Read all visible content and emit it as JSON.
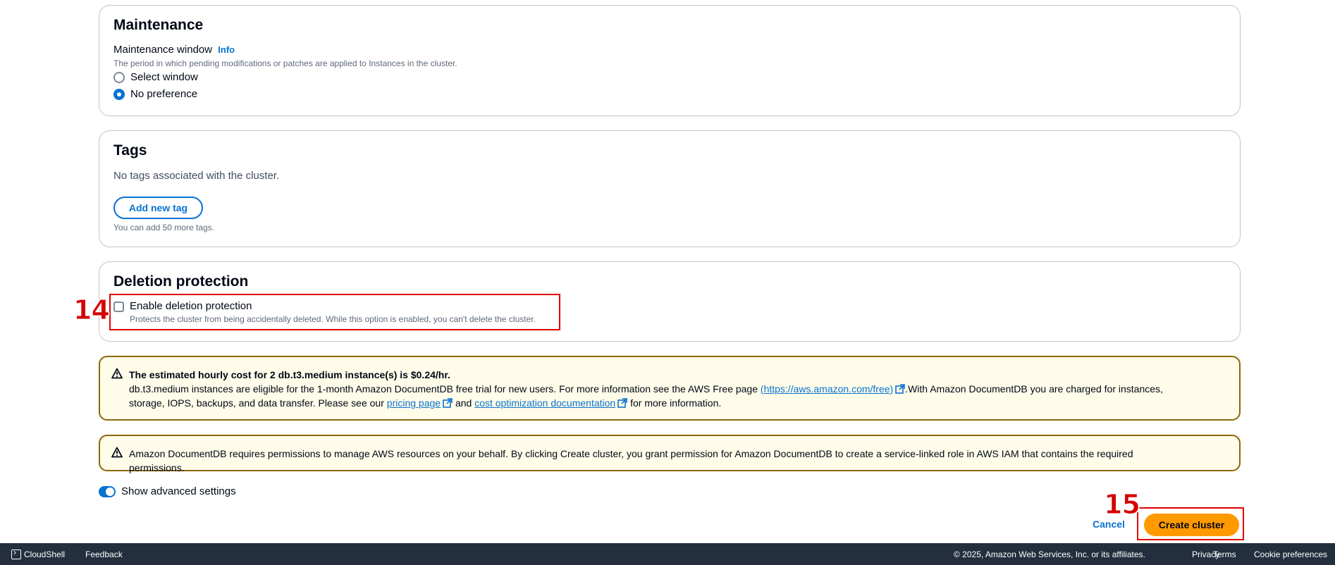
{
  "maintenance": {
    "title": "Maintenance",
    "field_label": "Maintenance window",
    "info_label": "Info",
    "description": "The period in which pending modifications or patches are applied to Instances in the cluster.",
    "options": [
      {
        "label": "Select window",
        "selected": false
      },
      {
        "label": "No preference",
        "selected": true
      }
    ]
  },
  "tags": {
    "title": "Tags",
    "empty_text": "No tags associated with the cluster.",
    "add_button": "Add new tag",
    "note": "You can add 50 more tags."
  },
  "deletion": {
    "title": "Deletion protection",
    "checkbox_label": "Enable deletion protection",
    "checkbox_desc": "Protects the cluster from being accidentally deleted. While this option is enabled, you can't delete the cluster.",
    "checked": false
  },
  "annotations": {
    "step14": "14",
    "step15": "15"
  },
  "cost_alert": {
    "heading": "The estimated hourly cost for 2 db.t3.medium instance(s) is $0.24/hr.",
    "text_part1": "db.t3.medium instances are eligible for the 1-month Amazon DocumentDB free trial for new users. For more information see the AWS Free page ",
    "free_link": "(https://aws.amazon.com/free)",
    "text_part2": ".With Amazon DocumentDB you are charged for instances, storage, IOPS, backups, and data transfer. Please see our ",
    "pricing_link": "pricing page",
    "text_part3": " and ",
    "cost_link": "cost optimization documentation",
    "text_part4": " for more information."
  },
  "permission_alert": {
    "text": "Amazon DocumentDB requires permissions to manage AWS resources on your behalf. By clicking Create cluster, you grant permission for Amazon DocumentDB to create a service-linked role in AWS IAM that contains the required permissions."
  },
  "advanced": {
    "toggle_label": "Show advanced settings",
    "enabled": true
  },
  "actions": {
    "cancel": "Cancel",
    "create": "Create cluster"
  },
  "footer": {
    "cloudshell": "CloudShell",
    "feedback": "Feedback",
    "copyright": "© 2025, Amazon Web Services, Inc. or its affiliates.",
    "privacy": "Privacy",
    "terms": "Terms",
    "cookies": "Cookie preferences"
  },
  "colors": {
    "accent": "#0972d3",
    "primary_button": "#ff9900",
    "warning_border": "#8d6605",
    "warning_bg": "#fffce9",
    "annotation_red": "#e00000",
    "footer_bg": "#232f3e"
  }
}
